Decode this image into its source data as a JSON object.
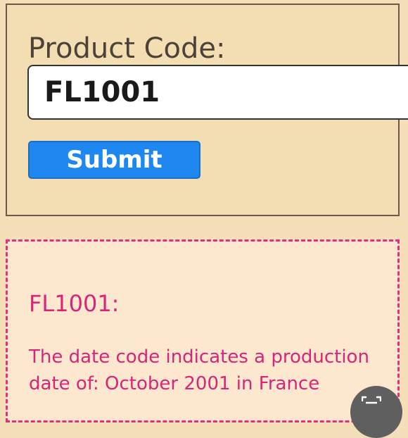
{
  "form": {
    "label": "Product Code:",
    "input_value": "FL1001",
    "submit_label": "Submit"
  },
  "result": {
    "title": "FL1001:",
    "message": "The date code indicates a production date of: October 2001 in France"
  },
  "colors": {
    "form_background": "#f3ddb2",
    "button": "#1e88f0",
    "result_background": "#fde7cf",
    "result_accent": "#d6267a"
  },
  "icons": {
    "scan_button": "scan-text-icon"
  }
}
